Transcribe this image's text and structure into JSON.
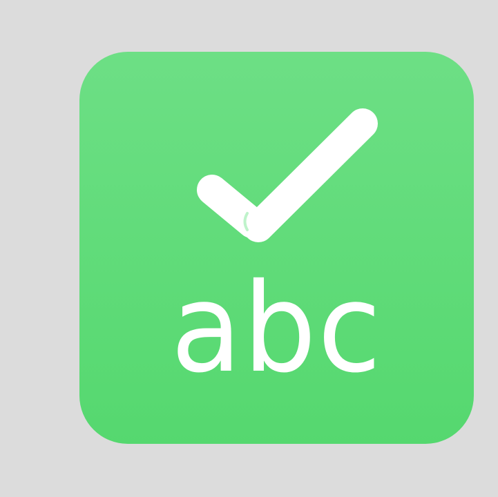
{
  "icon": {
    "text": "abc",
    "symbol": "checkmark-icon",
    "background_color": "#5fdb79",
    "foreground_color": "#ffffff"
  }
}
